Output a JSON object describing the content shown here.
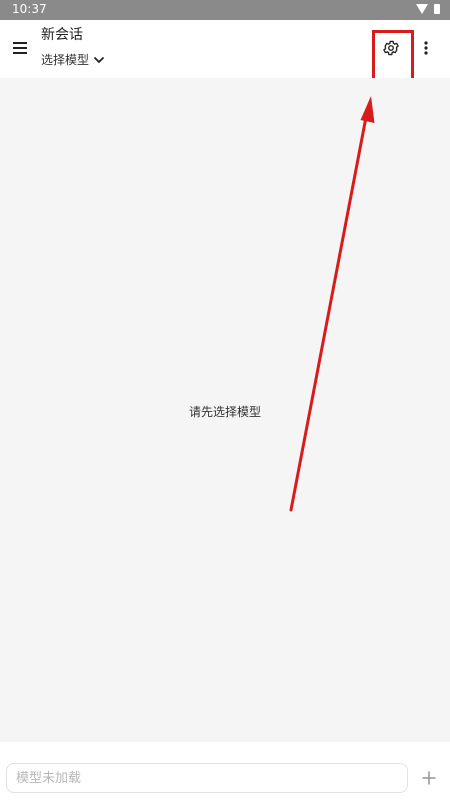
{
  "status_bar": {
    "time": "10:37"
  },
  "app_bar": {
    "menu_icon": "hamburger-menu-icon",
    "title": "新会话",
    "model_selector_label": "选择模型",
    "settings_icon": "gear-icon",
    "more_icon": "vertical-ellipsis-icon"
  },
  "main": {
    "empty_hint": "请先选择模型"
  },
  "composer": {
    "placeholder": "模型未加载",
    "value": "",
    "add_icon": "plus-icon"
  },
  "annotation": {
    "color": "#d81b1b",
    "target": "settings-button"
  }
}
